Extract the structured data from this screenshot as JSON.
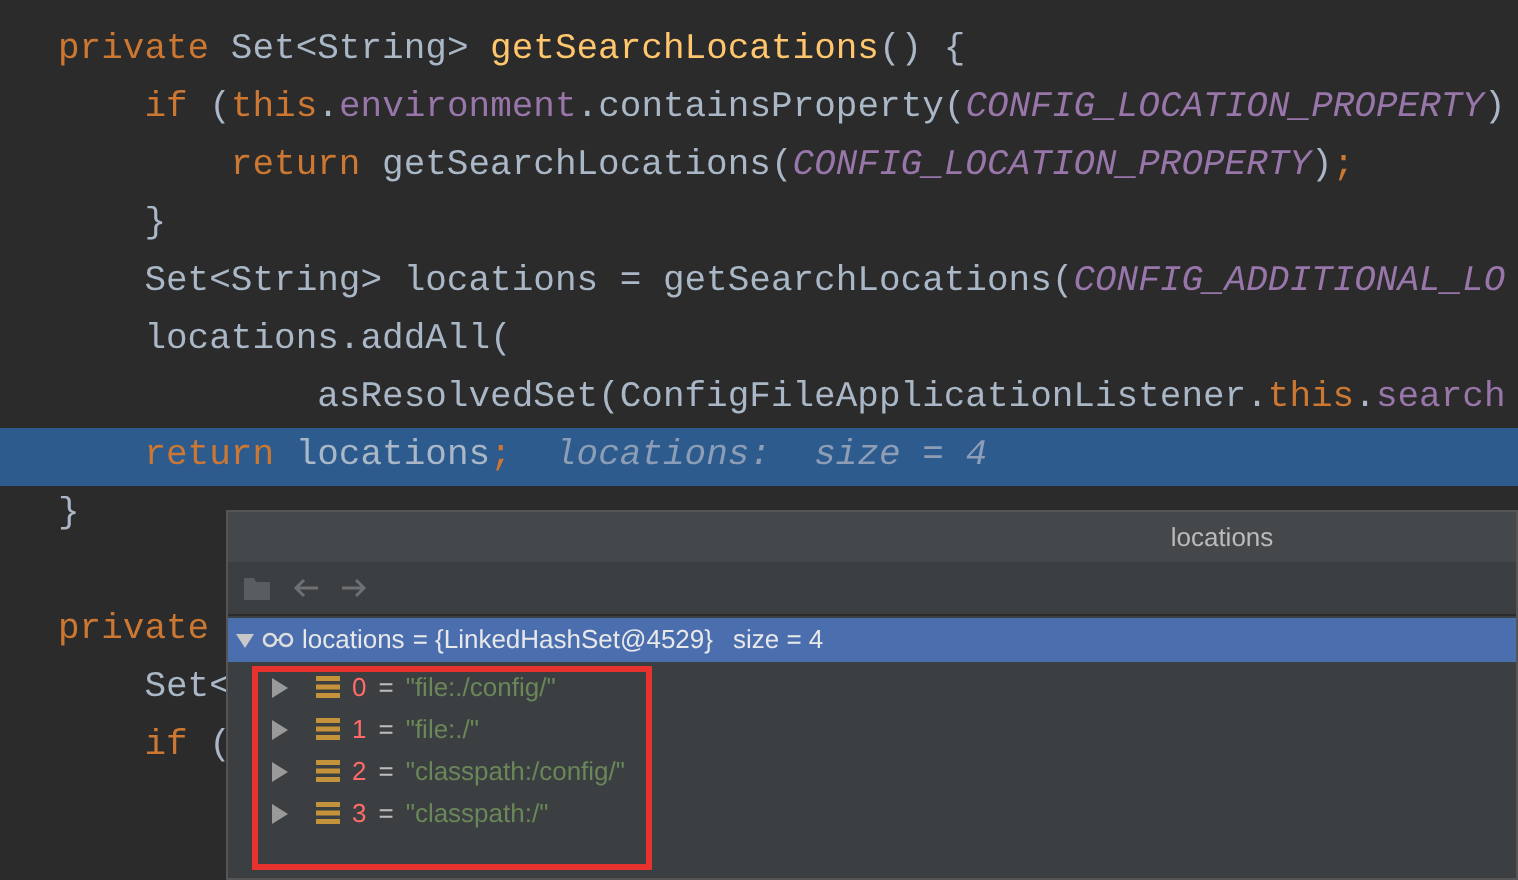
{
  "code_lines": [
    {
      "selected": false,
      "tokens": [
        {
          "kind": "keyword",
          "text": "private "
        },
        {
          "kind": "plain",
          "text": "Set<String> "
        },
        {
          "kind": "method",
          "text": "getSearchLocations"
        },
        {
          "kind": "plain",
          "text": "() {"
        }
      ]
    },
    {
      "selected": false,
      "tokens": [
        {
          "kind": "keyword",
          "text": "    if "
        },
        {
          "kind": "plain",
          "text": "("
        },
        {
          "kind": "keyword",
          "text": "this"
        },
        {
          "kind": "plain",
          "text": "."
        },
        {
          "kind": "field",
          "text": "environment"
        },
        {
          "kind": "plain",
          "text": ".containsProperty("
        },
        {
          "kind": "constant",
          "text": "CONFIG_LOCATION_PROPERTY"
        },
        {
          "kind": "plain",
          "text": ")"
        }
      ]
    },
    {
      "selected": false,
      "tokens": [
        {
          "kind": "keyword",
          "text": "        return "
        },
        {
          "kind": "plain",
          "text": "getSearchLocations("
        },
        {
          "kind": "constant",
          "text": "CONFIG_LOCATION_PROPERTY"
        },
        {
          "kind": "plain",
          "text": ")"
        },
        {
          "kind": "keyword",
          "text": ";"
        }
      ]
    },
    {
      "selected": false,
      "tokens": [
        {
          "kind": "plain",
          "text": "    }"
        }
      ]
    },
    {
      "selected": false,
      "tokens": [
        {
          "kind": "plain",
          "text": "    Set<String> locations = getSearchLocations("
        },
        {
          "kind": "constant",
          "text": "CONFIG_ADDITIONAL_LO"
        }
      ]
    },
    {
      "selected": false,
      "tokens": [
        {
          "kind": "plain",
          "text": "    locations.addAll("
        }
      ]
    },
    {
      "selected": false,
      "tokens": [
        {
          "kind": "plain",
          "text": "            asResolvedSet(ConfigFileApplicationListener."
        },
        {
          "kind": "keyword",
          "text": "this"
        },
        {
          "kind": "plain",
          "text": "."
        },
        {
          "kind": "field",
          "text": "search"
        }
      ]
    },
    {
      "selected": true,
      "tokens": [
        {
          "kind": "keyword",
          "text": "    return "
        },
        {
          "kind": "plain",
          "text": "locations"
        },
        {
          "kind": "keyword",
          "text": ";"
        },
        {
          "kind": "hint",
          "text": "  locations:  size = 4"
        }
      ]
    },
    {
      "selected": false,
      "tokens": [
        {
          "kind": "plain",
          "text": "}"
        }
      ]
    }
  ],
  "next_method_lines": [
    {
      "selected": false,
      "tokens": [
        {
          "kind": "keyword",
          "text": "private"
        }
      ]
    },
    {
      "selected": false,
      "tokens": [
        {
          "kind": "plain",
          "text": "    Set<"
        }
      ]
    },
    {
      "selected": false,
      "tokens": [
        {
          "kind": "keyword",
          "text": "    if "
        },
        {
          "kind": "plain",
          "text": "("
        }
      ]
    }
  ],
  "popup": {
    "title": "locations",
    "root": {
      "expanded": true,
      "selected": true,
      "name": "locations",
      "value": "= {LinkedHashSet@4529}",
      "size": "size = 4"
    },
    "items": [
      {
        "index": "0",
        "equals": "=",
        "value": "\"file:./config/\""
      },
      {
        "index": "1",
        "equals": "=",
        "value": "\"file:./\""
      },
      {
        "index": "2",
        "equals": "=",
        "value": "\"classpath:/config/\""
      },
      {
        "index": "3",
        "equals": "=",
        "value": "\"classpath:/\""
      }
    ]
  }
}
